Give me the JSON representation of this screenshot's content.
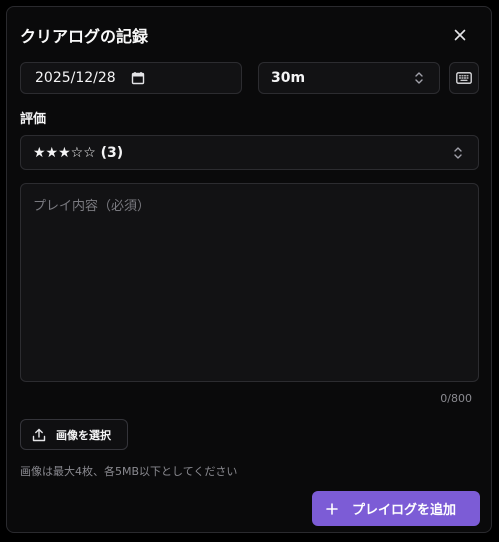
{
  "dialog": {
    "title": "クリアログの記録"
  },
  "form": {
    "date_value": "2025/12/28",
    "duration_value": "30m",
    "rating_label": "評価",
    "rating_value": "★★★☆☆ (3)",
    "content_placeholder": "プレイ内容（必須）",
    "char_counter": "0/800",
    "image_button_label": "画像を選択",
    "image_hint": "画像は最大4枚、各5MB以下としてください",
    "submit_label": "プレイログを追加"
  },
  "colors": {
    "accent": "#7c5cd6",
    "background": "#0a0a0b",
    "field": "#121214",
    "border": "#2c2c30"
  },
  "icons": {
    "close": "close-icon",
    "calendar": "calendar-icon",
    "chevron": "chevron-up-down-icon",
    "keyboard": "keyboard-icon",
    "upload": "upload-icon",
    "plus": "plus-icon"
  }
}
